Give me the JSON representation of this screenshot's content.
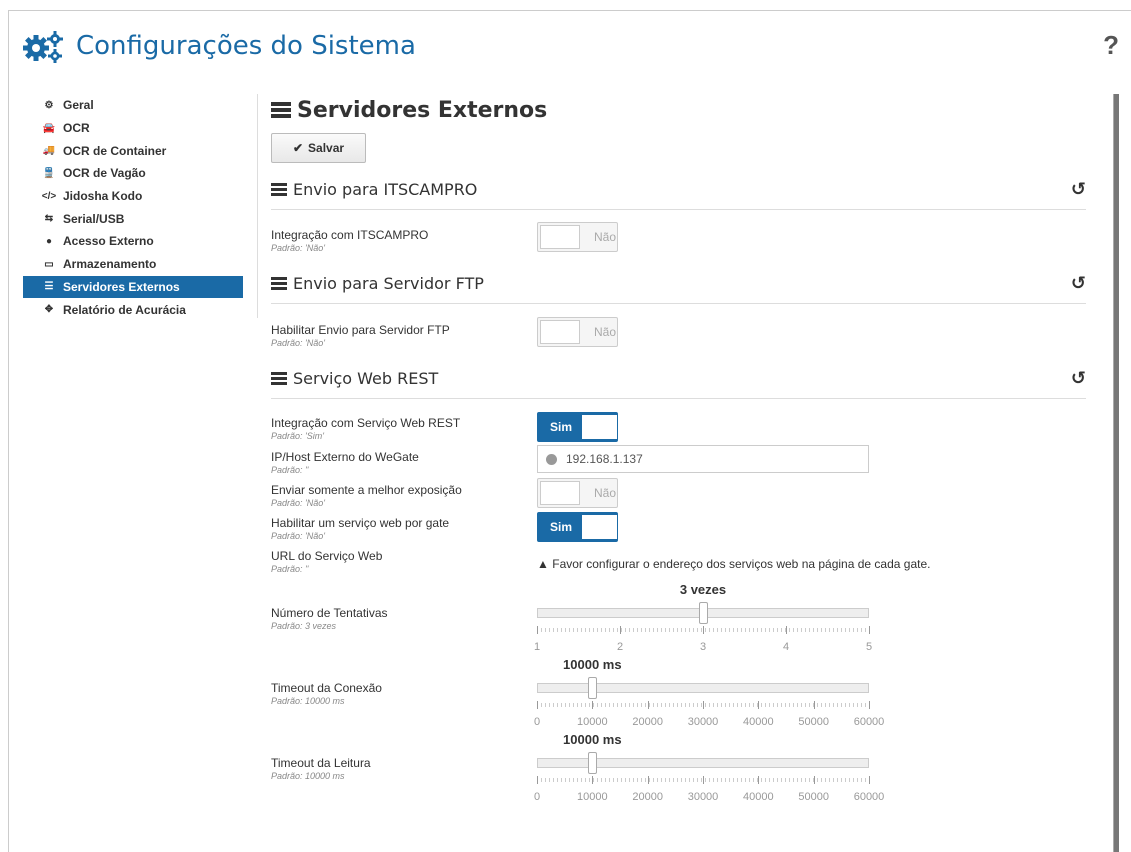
{
  "app": {
    "title": "Configurações do Sistema",
    "help": "?"
  },
  "sidebar": {
    "items": [
      {
        "label": "Geral",
        "icon": "gears-icon",
        "glyph": "⚙",
        "active": false
      },
      {
        "label": "OCR",
        "icon": "car-icon",
        "glyph": "🚘",
        "active": false
      },
      {
        "label": "OCR de Container",
        "icon": "truck-icon",
        "glyph": "🚚",
        "active": false
      },
      {
        "label": "OCR de Vagão",
        "icon": "train-icon",
        "glyph": "🚆",
        "active": false
      },
      {
        "label": "Jidosha Kodo",
        "icon": "code-icon",
        "glyph": "</>",
        "active": false
      },
      {
        "label": "Serial/USB",
        "icon": "usb-icon",
        "glyph": "⇆",
        "active": false
      },
      {
        "label": "Acesso Externo",
        "icon": "globe-icon",
        "glyph": "●",
        "active": false
      },
      {
        "label": "Armazenamento",
        "icon": "hdd-icon",
        "glyph": "▭",
        "active": false
      },
      {
        "label": "Servidores Externos",
        "icon": "server-icon",
        "glyph": "☰",
        "active": true
      },
      {
        "label": "Relatório de Acurácia",
        "icon": "crosshair-icon",
        "glyph": "✥",
        "active": false
      }
    ]
  },
  "page": {
    "title": "Servidores Externos",
    "save_label": "Salvar",
    "save_icon": "✔"
  },
  "sections": {
    "itscampro": {
      "title": "Envio para ITSCAMPRO",
      "field": {
        "label": "Integração com ITSCAMPRO",
        "default": "Padrão: 'Não'",
        "toggle": "Não"
      }
    },
    "ftp": {
      "title": "Envio para Servidor FTP",
      "field": {
        "label": "Habilitar Envio para Servidor FTP",
        "default": "Padrão: 'Não'",
        "toggle": "Não"
      }
    },
    "rest": {
      "title": "Serviço Web REST",
      "integration": {
        "label": "Integração com Serviço Web REST",
        "default": "Padrão: 'Sim'",
        "toggle": "Sim"
      },
      "host": {
        "label": "IP/Host Externo do WeGate",
        "default": "Padrão: ''",
        "value": "192.168.1.137"
      },
      "best_exposure": {
        "label": "Enviar somente a melhor exposição",
        "default": "Padrão: 'Não'",
        "toggle": "Não"
      },
      "per_gate": {
        "label": "Habilitar um serviço web por gate",
        "default": "Padrão: 'Não'",
        "toggle": "Sim"
      },
      "url": {
        "label": "URL do Serviço Web",
        "default": "Padrão: ''",
        "warning": "Favor configurar o endereço dos serviços web na página de cada gate."
      },
      "retries": {
        "label": "Número de Tentativas",
        "default": "Padrão: 3 vezes",
        "value_text": "3 vezes",
        "value": 3,
        "min": 1,
        "max": 5,
        "tick_labels": [
          "1",
          "2",
          "3",
          "4",
          "5"
        ]
      },
      "conn_timeout": {
        "label": "Timeout da Conexão",
        "default": "Padrão: 10000 ms",
        "value_text": "10000 ms",
        "value": 10000,
        "min": 0,
        "max": 60000,
        "tick_labels": [
          "0",
          "10000",
          "20000",
          "30000",
          "40000",
          "50000",
          "60000"
        ]
      },
      "read_timeout": {
        "label": "Timeout da Leitura",
        "default": "Padrão: 10000 ms",
        "value_text": "10000 ms",
        "value": 10000,
        "min": 0,
        "max": 60000,
        "tick_labels": [
          "0",
          "10000",
          "20000",
          "30000",
          "40000",
          "50000",
          "60000"
        ]
      }
    }
  },
  "colors": {
    "accent": "#1a6aa6"
  }
}
